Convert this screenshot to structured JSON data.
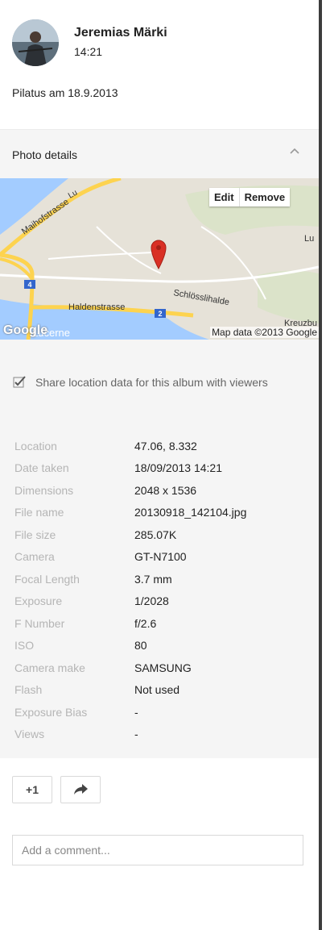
{
  "post": {
    "author": "Jeremias Märki",
    "time": "14:21",
    "caption": "Pilatus am 18.9.2013"
  },
  "details": {
    "title": "Photo details",
    "collapse_icon": "chevron-up-icon",
    "map": {
      "edit_label": "Edit",
      "remove_label": "Remove",
      "labels": {
        "street1": "Maihofstrasse",
        "street2": "Haldenstrasse",
        "place1": "Schlösslihalde",
        "place2": "Lucerne",
        "place3": "Kreuzbu",
        "road1": "4",
        "road2": "2",
        "logo": "Google",
        "top_right": "Lu",
        "top_fragment": "Lu"
      },
      "attribution": "Map data ©2013 Google"
    },
    "share_location": {
      "checked": true,
      "label": "Share location data for this album with viewers"
    },
    "metadata": [
      {
        "key": "Location",
        "value": "47.06, 8.332"
      },
      {
        "key": "Date taken",
        "value": "18/09/2013 14:21"
      },
      {
        "key": "Dimensions",
        "value": "2048 x 1536"
      },
      {
        "key": "File name",
        "value": "20130918_142104.jpg"
      },
      {
        "key": "File size",
        "value": "285.07K"
      },
      {
        "key": "Camera",
        "value": "GT-N7100"
      },
      {
        "key": "Focal Length",
        "value": "3.7 mm"
      },
      {
        "key": "Exposure",
        "value": "1/2028"
      },
      {
        "key": "F Number",
        "value": "f/2.6"
      },
      {
        "key": "ISO",
        "value": "80"
      },
      {
        "key": "Camera make",
        "value": "SAMSUNG"
      },
      {
        "key": "Flash",
        "value": "Not used"
      },
      {
        "key": "Exposure Bias",
        "value": "-"
      },
      {
        "key": "Views",
        "value": "-"
      }
    ]
  },
  "actions": {
    "plus_one_label": "+1",
    "share_icon": "share-arrow-icon"
  },
  "comment": {
    "placeholder": "Add a comment..."
  },
  "colors": {
    "panel_bg": "#f5f5f5",
    "map_water": "#a3ccff",
    "map_land": "#e6e2d8",
    "map_highway": "#fdd34f",
    "map_road_label": "#3366cc",
    "marker": "#d93025"
  }
}
